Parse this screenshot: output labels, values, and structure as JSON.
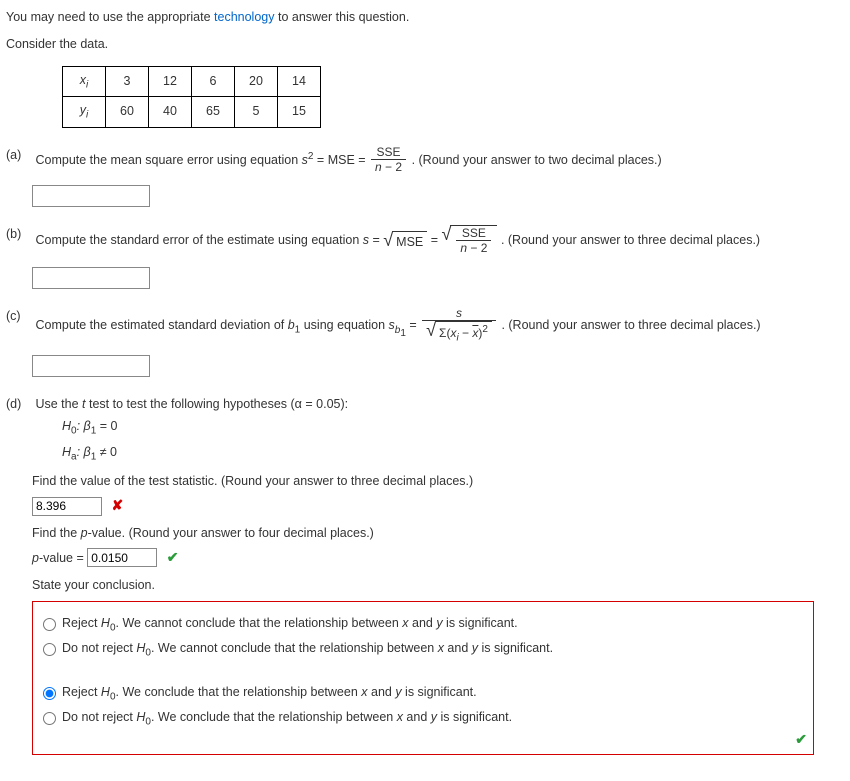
{
  "intro": {
    "pre": "You may need to use the appropriate ",
    "tech": "technology",
    "post": " to answer this question.",
    "consider": "Consider the data."
  },
  "table": {
    "rowhead_x": "x",
    "rowhead_x_sub": "i",
    "rowhead_y": "y",
    "rowhead_y_sub": "i",
    "x": [
      "3",
      "12",
      "6",
      "20",
      "14"
    ],
    "y": [
      "60",
      "40",
      "65",
      "5",
      "15"
    ]
  },
  "a": {
    "label": "(a)",
    "pre": "Compute the mean square error using equation ",
    "eq_lhs1": "s",
    "eq_sup": "2",
    "eq_mid": " = MSE = ",
    "frac_num": "SSE",
    "frac_den_pre": "n",
    "frac_den_post": " − 2",
    "post": ". (Round your answer to two decimal places.)"
  },
  "b": {
    "label": "(b)",
    "pre": "Compute the standard error of the estimate using equation ",
    "eq_s": "s",
    "eq_eq": " = ",
    "radicand1": "MSE",
    "mid": " = ",
    "frac_num": "SSE",
    "frac_den_pre": "n",
    "frac_den_post": " − 2",
    "post": ". (Round your answer to three decimal places.)"
  },
  "c": {
    "label": "(c)",
    "pre": "Compute the estimated standard deviation of ",
    "b1": "b",
    "b1sub": "1",
    "mid": " using equation ",
    "sb1": "s",
    "sb1sub": "b",
    "sb1subsub": "1",
    "eq": " = ",
    "num": "s",
    "den_pre": "Σ(",
    "den_x": "x",
    "den_xsub": "i",
    "den_mid": " − ",
    "den_xbar": "x",
    "den_post": ")",
    "den_sup": "2",
    "post": ". (Round your answer to three decimal places.)"
  },
  "d": {
    "label": "(d)",
    "intro_pre": "Use the ",
    "t": "t",
    "intro_post": " test to test the following hypotheses (α = 0.05):",
    "h0_pre": "H",
    "h0_sub": "0",
    "h0_mid": ": β",
    "h0_sub2": "1",
    "h0_post": " = 0",
    "ha_pre": "H",
    "ha_sub": "a",
    "ha_mid": ": β",
    "ha_sub2": "1",
    "ha_post": " ≠ 0",
    "find_t": "Find the value of the test statistic. (Round your answer to three decimal places.)",
    "t_value": "8.396",
    "find_p_pre": "Find the ",
    "p": "p",
    "find_p_post": "-value. (Round your answer to four decimal places.)",
    "p_label_pre": "p",
    "p_label_post": "-value = ",
    "p_value": "0.0150",
    "state": "State your conclusion.",
    "choices": [
      "Reject H0. We cannot conclude that the relationship between x and y is significant.",
      "Do not reject H0. We cannot conclude that the relationship between x and y is significant.",
      "Reject H0. We conclude that the relationship between x and y is significant.",
      "Do not reject H0. We conclude that the relationship between x and y is significant."
    ],
    "choice_pre": [
      "Reject ",
      "Do not reject ",
      "Reject ",
      "Do not reject "
    ],
    "choice_H": "H",
    "choice_sub": "0",
    "choice_post": [
      ". We cannot conclude that the relationship between ",
      ". We cannot conclude that the relationship between ",
      ". We conclude that the relationship between ",
      ". We conclude that the relationship between "
    ],
    "xy_x": "x",
    "xy_and": " and ",
    "xy_y": "y",
    "choice_tail": " is significant.",
    "selected": 2
  }
}
